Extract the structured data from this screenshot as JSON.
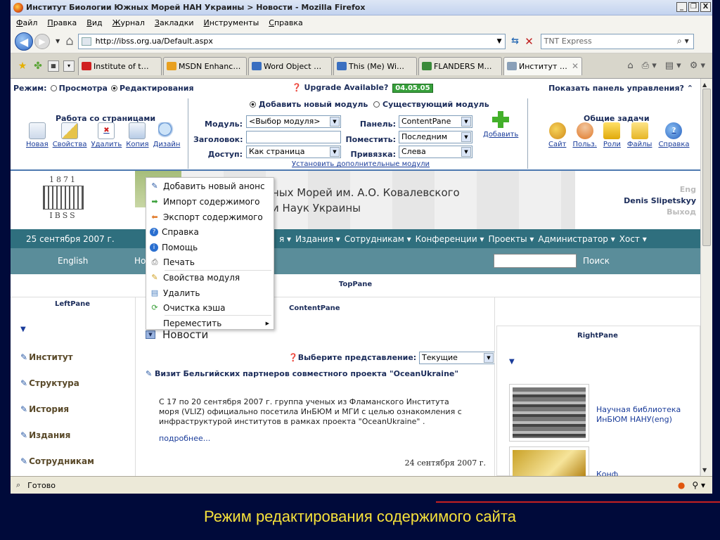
{
  "window": {
    "title": "Институт Биологии Южных Морей НАН Украины > Новости - Mozilla Firefox",
    "controls": [
      "_",
      "❐",
      "X"
    ]
  },
  "menubar": [
    "Файл",
    "Правка",
    "Вид",
    "Журнал",
    "Закладки",
    "Инструменты",
    "Справка"
  ],
  "navbar": {
    "url": "http://ibss.org.ua/Default.aspx",
    "search_value": "TNT Express"
  },
  "tabs": [
    {
      "label": "Institute of t…",
      "color": "#d02020"
    },
    {
      "label": "MSDN Enhanc…",
      "color": "#e8a020"
    },
    {
      "label": "Word Object …",
      "color": "#3a6fc0"
    },
    {
      "label": "This (Me) Wi…",
      "color": "#3a6fc0"
    },
    {
      "label": "FLANDERS M…",
      "color": "#3a8a3a"
    },
    {
      "label": "Институт …",
      "color": "#8aa0b8",
      "active": true
    }
  ],
  "control_panel": {
    "mode_label": "Режим:",
    "mode_view": "Просмотра",
    "mode_edit": "Редактирования",
    "upgrade": "Upgrade Available?",
    "version": "04.05.05",
    "show_panel": "Показать панель управления?",
    "pages_title": "Работа со страницами",
    "pages_actions": [
      "Новая",
      "Свойства",
      "Удалить",
      "Копия",
      "Дизайн"
    ],
    "add_new_module": "Добавить новый модуль",
    "existing_module": "Существующий модуль",
    "module_label": "Модуль:",
    "module_value": "<Выбор модуля>",
    "title_label": "Заголовок:",
    "access_label": "Доступ:",
    "access_value": "Как страница",
    "pane_label": "Панель:",
    "pane_value": "ContentPane",
    "insert_label": "Поместить:",
    "insert_value": "Последним",
    "align_label": "Привязка:",
    "align_value": "Слева",
    "add_button": "Добавить",
    "install_more": "Установить дополнительные модули",
    "common_title": "Общие задачи",
    "common_actions": [
      "Сайт",
      "Польз.",
      "Роли",
      "Файлы",
      "Справка"
    ]
  },
  "header": {
    "logo_year": "1871",
    "logo_text": "IBSS",
    "org_line1": "ных Морей им. А.О. Ковалевского",
    "org_line2": "и Наук Украины",
    "eng": "Eng",
    "user": "Denis Slipetskyy",
    "exit": "Выход"
  },
  "nav": {
    "date": "25 сентября 2007 г.",
    "items": [
      "я ▾",
      "Издания ▾",
      "Сотрудникам ▾",
      "Конференции ▾",
      "Проекты ▾",
      "Администратор ▾",
      "Хост ▾"
    ],
    "bullet": "▸",
    "english": "English",
    "home_partial": "Но",
    "search_btn": "Поиск"
  },
  "panes": {
    "top": "TopPane",
    "left": "LeftPane",
    "content": "ContentPane",
    "right": "RightPane"
  },
  "left_menu": [
    "Институт",
    "Структура",
    "История",
    "Издания",
    "Сотрудникам"
  ],
  "context_menu": [
    {
      "label": "Добавить новый анонс",
      "icon": "✎"
    },
    {
      "label": "Импорт содержимого",
      "icon": "➡"
    },
    {
      "label": "Экспорт содержимого",
      "icon": "⬅"
    },
    {
      "label": "Справка",
      "icon": "?"
    },
    {
      "label": "Помощь",
      "icon": "i"
    },
    {
      "label": "Печать",
      "icon": "⎙"
    },
    {
      "label": "Свойства модуля",
      "icon": "✎"
    },
    {
      "label": "Удалить",
      "icon": "▤"
    },
    {
      "label": "Очистка кэша",
      "icon": "⟳"
    },
    {
      "label": "Переместить",
      "icon": "",
      "submenu": true
    }
  ],
  "news": {
    "module_title": "Новости",
    "view_label": "Выберите представление:",
    "view_value": "Текущие",
    "headline": "Визит Бельгийских партнеров совместного проекта \"OceanUkraine\"",
    "body": "С 17 по 20 сентября 2007 г. группа ученых из Фламанского Института моря (VLIZ) официально посетила ИнБЮМ и МГИ с целью ознакомления с инфраструктурой институтов в рамках проекта  \"OceanUkraine\" .",
    "more": "подробнее...",
    "date": "24 сентября 2007 г."
  },
  "right": {
    "library": "Научная библиотека ИнБЮМ НАНУ(eng)",
    "conf": "Конф"
  },
  "status": {
    "text": "Готово"
  },
  "caption": "Режим редактирования содержимого сайта"
}
